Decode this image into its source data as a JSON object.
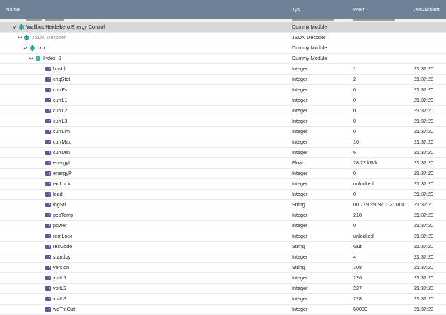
{
  "header": {
    "name": "Name",
    "typ": "Typ",
    "wert": "Wert",
    "aktualisiert": "Aktualisiert"
  },
  "tree": [
    {
      "name": "Wallbox Heidelberg Energy Control",
      "typ": "Dummy Module",
      "level": 1,
      "icon": "instance-icon",
      "selected": true,
      "muted": false
    },
    {
      "name": "JSON Decoder",
      "typ": "JSON Decoder",
      "level": 2,
      "icon": "instance-icon",
      "selected": false,
      "muted": true
    },
    {
      "name": "box",
      "typ": "Dummy Module",
      "level": 3,
      "icon": "instance-icon",
      "selected": false,
      "muted": false
    },
    {
      "name": "Index_0",
      "typ": "Dummy Module",
      "level": 4,
      "icon": "instance-icon",
      "selected": false,
      "muted": false
    }
  ],
  "variables": [
    {
      "name": "busId",
      "typ": "Integer",
      "wert": "1",
      "akt": "21:37:20"
    },
    {
      "name": "chgStat",
      "typ": "Integer",
      "wert": "2",
      "akt": "21:37:20"
    },
    {
      "name": "currFs",
      "typ": "Integer",
      "wert": "0",
      "akt": "21:37:20"
    },
    {
      "name": "currL1",
      "typ": "Integer",
      "wert": "0",
      "akt": "21:37:20"
    },
    {
      "name": "currL2",
      "typ": "Integer",
      "wert": "0",
      "akt": "21:37:20"
    },
    {
      "name": "currL3",
      "typ": "Integer",
      "wert": "0",
      "akt": "21:37:20"
    },
    {
      "name": "currLim",
      "typ": "Integer",
      "wert": "0",
      "akt": "21:37:20"
    },
    {
      "name": "currMax",
      "typ": "Integer",
      "wert": "16",
      "akt": "21:37:20"
    },
    {
      "name": "currMin",
      "typ": "Integer",
      "wert": "6",
      "akt": "21:37:20"
    },
    {
      "name": "energyI",
      "typ": "Float",
      "wert": "28,22 kWh",
      "akt": "21:37:20"
    },
    {
      "name": "energyP",
      "typ": "Integer",
      "wert": "0",
      "akt": "21:37:20"
    },
    {
      "name": "extLock",
      "typ": "Integer",
      "wert": "unlocked",
      "akt": "21:37:20"
    },
    {
      "name": "load",
      "typ": "Integer",
      "wert": "0",
      "akt": "21:37:20"
    },
    {
      "name": "logStr",
      "typ": "String",
      "wert": "00.779.2909/01 2118 00...",
      "akt": "21:37:20"
    },
    {
      "name": "pcbTemp",
      "typ": "Integer",
      "wert": "218",
      "akt": "21:37:20"
    },
    {
      "name": "power",
      "typ": "Integer",
      "wert": "0",
      "akt": "21:37:20"
    },
    {
      "name": "remLock",
      "typ": "Integer",
      "wert": "unlocked",
      "akt": "21:37:20"
    },
    {
      "name": "resCode",
      "typ": "String",
      "wert": "Gut",
      "akt": "21:37:20"
    },
    {
      "name": "standby",
      "typ": "Integer",
      "wert": "4",
      "akt": "21:37:20"
    },
    {
      "name": "version",
      "typ": "String",
      "wert": "108",
      "akt": "21:37:20"
    },
    {
      "name": "voltL1",
      "typ": "Integer",
      "wert": "226",
      "akt": "21:37:20"
    },
    {
      "name": "voltL2",
      "typ": "Integer",
      "wert": "227",
      "akt": "21:37:20"
    },
    {
      "name": "voltL3",
      "typ": "Integer",
      "wert": "228",
      "akt": "21:37:20"
    },
    {
      "name": "wdTmOut",
      "typ": "Integer",
      "wert": "60000",
      "akt": "21:37:20"
    }
  ],
  "colors": {
    "header_bg": "#6e8197",
    "instance_icon": "#3bb3a6",
    "variable_icon": "#6b4fa0",
    "selected_row": "#d8d8d8"
  }
}
